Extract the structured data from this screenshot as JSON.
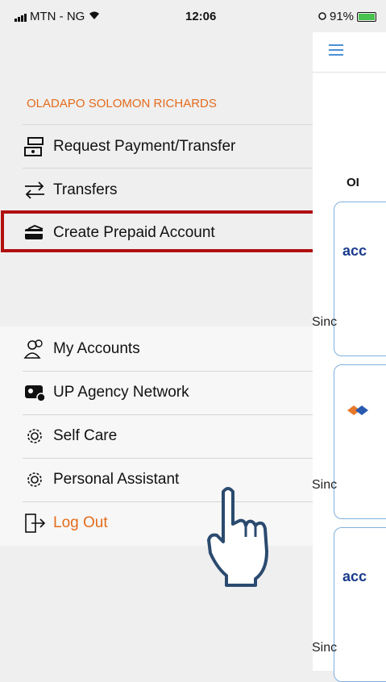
{
  "status_bar": {
    "carrier": "MTN - NG",
    "time": "12:06",
    "battery": "91%"
  },
  "drawer": {
    "user_name": "OLADAPO SOLOMON RICHARDS",
    "items": [
      {
        "label": "Request Payment/Transfer",
        "icon": "payment-request-icon"
      },
      {
        "label": "Transfers",
        "icon": "transfer-arrows-icon"
      },
      {
        "label": "Create Prepaid Account",
        "icon": "card-icon"
      }
    ],
    "items2": [
      {
        "label": "My Accounts",
        "icon": "users-icon"
      },
      {
        "label": "UP Agency Network",
        "icon": "agency-icon"
      },
      {
        "label": "Self Care",
        "icon": "gear-icon"
      },
      {
        "label": "Personal Assistant",
        "icon": "gear-icon"
      },
      {
        "label": "Log Out",
        "icon": "logout-icon"
      }
    ]
  },
  "right_pane": {
    "heading_fragment": "OI",
    "cards": [
      {
        "brand": "acc",
        "since": "Sinc"
      },
      {
        "brand": "",
        "since": "Sinc"
      },
      {
        "brand": "acc",
        "since": "Sinc"
      }
    ]
  },
  "colors": {
    "accent_orange": "#e46b1c",
    "highlight_red": "#b01010",
    "link_blue": "#4a8fd8"
  }
}
